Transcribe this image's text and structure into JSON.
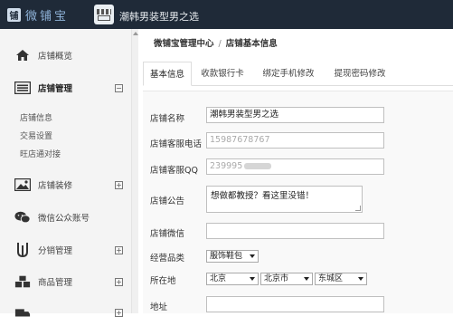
{
  "header": {
    "logo_mark": "铺",
    "logo_text": "微铺宝",
    "store_name": "潮韩男装型男之选"
  },
  "sidebar": {
    "items": [
      {
        "label": "店铺概览",
        "icon": "home-icon"
      },
      {
        "label": "店铺管理",
        "icon": "list-icon",
        "toggle": "⊟"
      },
      {
        "label": "店铺装修",
        "icon": "image-icon",
        "toggle": "⊞"
      },
      {
        "label": "微信公众账号",
        "icon": "chat-icon"
      },
      {
        "label": "分销管理",
        "icon": "distribution-icon",
        "toggle": "⊞"
      },
      {
        "label": "商品管理",
        "icon": "goods-icon",
        "toggle": "⊞"
      }
    ],
    "subitems": [
      "店铺信息",
      "交易设置",
      "旺店通对接"
    ]
  },
  "breadcrumb": {
    "root": "微铺宝管理中心",
    "separator": "/",
    "current": "店铺基本信息"
  },
  "tabs": [
    "基本信息",
    "收款银行卡",
    "绑定手机修改",
    "提现密码修改"
  ],
  "form": {
    "store_name_label": "店铺名称",
    "store_name_value": "潮韩男装型男之选",
    "phone_label": "店铺客服电话",
    "phone_value": "15987678767",
    "qq_label": "店铺客服QQ",
    "qq_value": "239995",
    "notice_label": "店铺公告",
    "notice_value": "想做都教授？看这里没错！",
    "wechat_label": "店铺微信",
    "wechat_value": "",
    "category_label": "经营品类",
    "category_value": "服饰鞋包",
    "location_label": "所在地",
    "province": "北京",
    "city": "北京市",
    "district": "东城区",
    "address_label": "地址",
    "address_value": ""
  },
  "colors": {
    "topbar": "#1f2a38",
    "sidebar": "#f4f4f4",
    "logo": "#8fb3d9"
  }
}
